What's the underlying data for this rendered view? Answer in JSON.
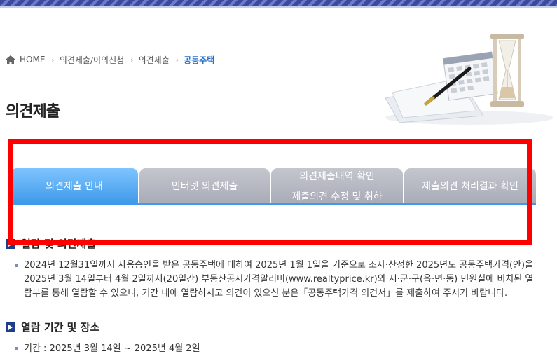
{
  "breadcrumb": {
    "home": "HOME",
    "items": [
      "의견제출/이의신청",
      "의견제출",
      "공동주택"
    ]
  },
  "page_title": "의견제출",
  "tabs": [
    {
      "label": "의견제출 안내",
      "active": true
    },
    {
      "label": "인터넷 의견제출",
      "active": false
    },
    {
      "label_line1": "의견제출내역 확인",
      "label_line2": "제출의견 수정 및 취하",
      "active": false
    },
    {
      "label": "제출의견 처리결과 확인",
      "active": false
    }
  ],
  "sections": [
    {
      "title": "열람 및 의견제출",
      "text": "2024년 12월31일까지 사용승인을 받은 공동주택에 대하여 2025년 1월 1일을 기준으로 조사·산정한 2025년도 공동주택가격(안)을 2025년 3월 14일부터 4월 2일까지(20일간) 부동산공시가격알리미(www.realtyprice.kr)와 시·군·구(읍·면·동) 민원실에 비치된 열람부를 통해 열람할 수 있으니, 기간 내에 열람하시고 의견이 있으신 분은「공동주택가격 의견서」를 제출하여 주시기 바랍니다."
    },
    {
      "title": "열람 기간 및 장소",
      "text": "기간 : 2025년 3월 14일 ~ 2025년 4월 2일"
    }
  ],
  "colors": {
    "active_tab": "#3f9ae9",
    "inactive_tab": "#b2b5bf",
    "highlight": "#ff0000",
    "accent_text": "#2a6fc7"
  }
}
